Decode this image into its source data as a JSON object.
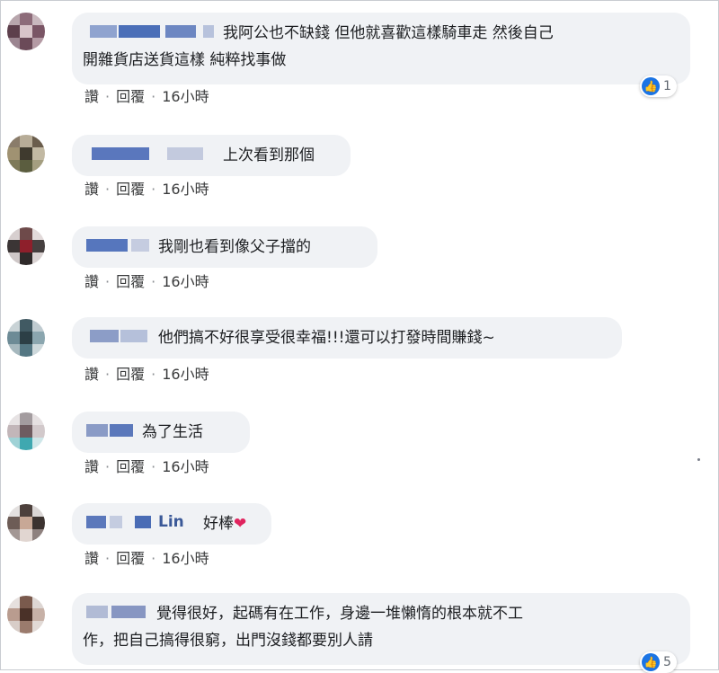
{
  "comments": [
    {
      "text": "我阿公也不缺錢 但他就喜歡這樣騎車走 然後自己開雜貨店送貨這樣 純粹找事做",
      "line1": "我阿公也不缺錢 但他就喜歡這樣騎車走 然後自己",
      "line2": "開雜貨店送貨這樣 純粹找事做",
      "like": "讚",
      "reply": "回覆",
      "time": "16小時",
      "reaction_count": "1"
    },
    {
      "text": "上次看到那個",
      "like": "讚",
      "reply": "回覆",
      "time": "16小時"
    },
    {
      "text": "我剛也看到像父子擋的",
      "like": "讚",
      "reply": "回覆",
      "time": "16小時"
    },
    {
      "text": "他們搞不好很享受很幸福!!!還可以打發時間賺錢~",
      "like": "讚",
      "reply": "回覆",
      "time": "16小時"
    },
    {
      "text": "為了生活",
      "like": "讚",
      "reply": "回覆",
      "time": "16小時"
    },
    {
      "name_visible": "Lin",
      "text": "好棒",
      "emoji": "❤",
      "like": "讚",
      "reply": "回覆",
      "time": "16小時"
    },
    {
      "text": "覺得很好，起碼有在工作，身邊一堆懶惰的根本就不工作，把自己搞得很窮，出門沒錢都要別人請",
      "line1": "覺得很好，起碼有在工作，身邊一堆懶惰的根本就不工",
      "line2": "作，把自己搞得很窮，出門沒錢都要別人請",
      "reaction_count": "5"
    }
  ],
  "colors": {
    "bubble": "#f0f2f5",
    "link": "#3b5998",
    "like_badge": "#1b74e4"
  },
  "icons": {
    "reaction": "thumbs-up-icon"
  }
}
